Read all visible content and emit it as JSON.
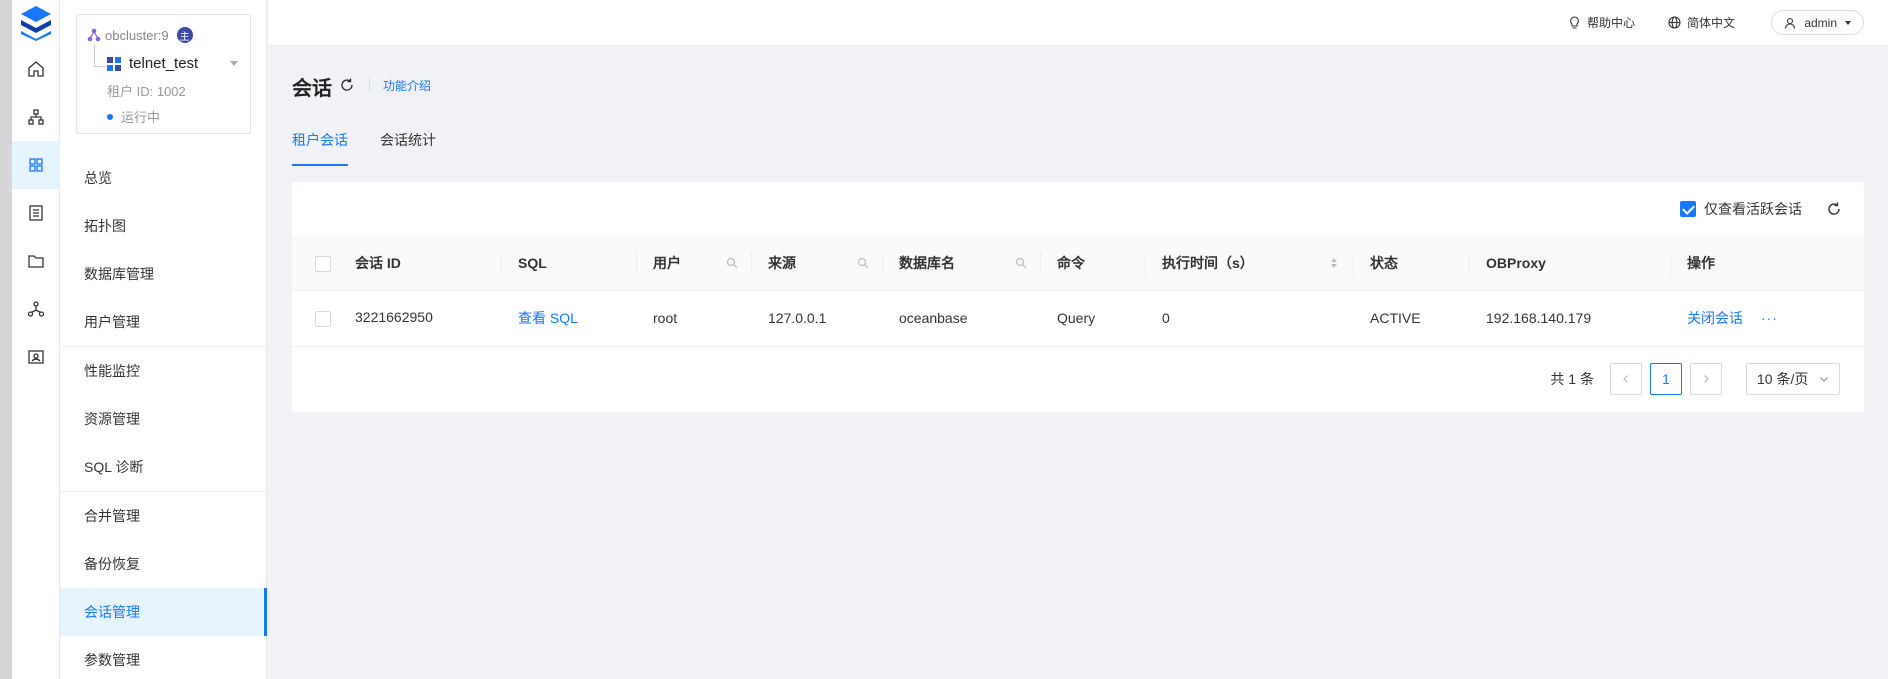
{
  "sidebar": {
    "cluster_name": "obcluster:9",
    "cluster_badge": "主",
    "tenant_name": "telnet_test",
    "tenant_id": "租户 ID: 1002",
    "tenant_status": "运行中",
    "items": [
      {
        "label": "总览"
      },
      {
        "label": "拓扑图"
      },
      {
        "label": "数据库管理"
      },
      {
        "label": "用户管理"
      },
      {
        "label": "性能监控"
      },
      {
        "label": "资源管理"
      },
      {
        "label": "SQL 诊断"
      },
      {
        "label": "合并管理"
      },
      {
        "label": "备份恢复"
      },
      {
        "label": "会话管理"
      },
      {
        "label": "参数管理"
      }
    ]
  },
  "header": {
    "help": "帮助中心",
    "language": "简体中文",
    "user": "admin"
  },
  "page": {
    "title": "会话",
    "intro_link": "功能介绍",
    "tabs": [
      {
        "label": "租户会话"
      },
      {
        "label": "会话统计"
      }
    ]
  },
  "toolbar": {
    "only_active_label": "仅查看活跃会话"
  },
  "table": {
    "columns": [
      "会话 ID",
      "SQL",
      "用户",
      "来源",
      "数据库名",
      "命令",
      "执行时间（s）",
      "状态",
      "OBProxy",
      "操作"
    ],
    "rows": [
      {
        "session_id": "3221662950",
        "sql": "查看 SQL",
        "user": "root",
        "source": "127.0.0.1",
        "database": "oceanbase",
        "command": "Query",
        "exec_time": "0",
        "status": "ACTIVE",
        "obproxy": "192.168.140.179",
        "action": "关闭会话",
        "more": "···"
      }
    ]
  },
  "pagination": {
    "total": "共 1 条",
    "current_page": "1",
    "page_size": "10 条/页"
  },
  "colors": {
    "primary": "#1677ff",
    "active_bg": "#e6f4ff",
    "logo": "#1677ff"
  }
}
